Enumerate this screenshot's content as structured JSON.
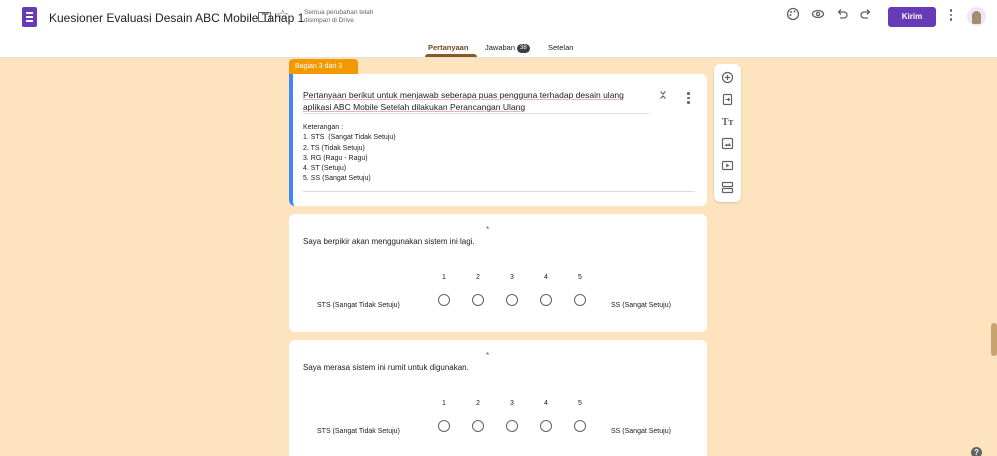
{
  "header": {
    "doc_title": "Kuesioner Evaluasi Desain ABC Mobile Tahap 1",
    "save_status": "Semua perubahan telah disimpan di Drive",
    "send_label": "Kirim",
    "icons": [
      "palette-icon",
      "preview-eye-icon",
      "undo-icon",
      "redo-icon",
      "more-vert-icon"
    ]
  },
  "tabs": {
    "questions": "Pertanyaan",
    "responses": "Jawaban",
    "responses_count": "38",
    "settings": "Setelan"
  },
  "section": {
    "badge": "Bagian 3 dari 3",
    "title": "Pertanyaan berikut untuk menjawab seberapa puas pengguna terhadap desain ulang aplikasi ABC Mobile Setelah dilakukan Perancangan Ulang",
    "description": [
      "Keterangan :",
      "1. STS  (Sangat Tidak Setuju)",
      "2. TS (Tidak Setuju)",
      "3. RG (Ragu - Ragu)",
      "4. ST (Setuju)",
      "5. SS (Sangat Setuju)"
    ]
  },
  "questions": [
    {
      "text": "Saya berpikir akan menggunakan sistem ini lagi.",
      "required_mark": "*",
      "scale": [
        "1",
        "2",
        "3",
        "4",
        "5"
      ],
      "low_label": "STS (Sangat Tidak Setuju)",
      "high_label": "SS (Sangat Setuju)"
    },
    {
      "text": "Saya merasa sistem ini rumit untuk digunakan.",
      "required_mark": "*",
      "scale": [
        "1",
        "2",
        "3",
        "4",
        "5"
      ],
      "low_label": "STS (Sangat Tidak Setuju)",
      "high_label": "SS (Sangat Setuju)"
    }
  ],
  "toolbar": [
    "add-question-icon",
    "import-questions-icon",
    "add-title-icon",
    "add-image-icon",
    "add-video-icon",
    "add-section-icon"
  ],
  "help_label": "?",
  "theme": {
    "accent": "#673ab7",
    "background": "#fde4bf",
    "section_tab": "#f29900",
    "focus": "#4285f4"
  }
}
